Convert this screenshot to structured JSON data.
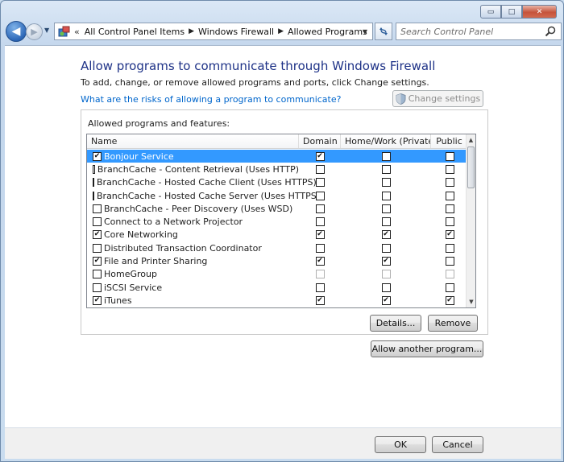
{
  "window": {
    "minimize_glyph": "▭",
    "maximize_glyph": "□",
    "close_glyph": "✕"
  },
  "nav": {
    "back_glyph": "◀",
    "forward_glyph": "▶",
    "breadcrumbs": [
      "All Control Panel Items",
      "Windows Firewall",
      "Allowed Programs"
    ],
    "search_placeholder": "Search Control Panel"
  },
  "page": {
    "title": "Allow programs to communicate through Windows Firewall",
    "subtitle": "To add, change, or remove allowed programs and ports, click Change settings.",
    "risk_link": "What are the risks of allowing a program to communicate?",
    "change_settings_label": "Change settings"
  },
  "allowed": {
    "group_label": "Allowed programs and features:",
    "columns": {
      "name": "Name",
      "domain": "Domain",
      "home": "Home/Work (Private)",
      "public": "Public"
    },
    "rows": [
      {
        "name": "Bonjour Service",
        "enabled": true,
        "domain": true,
        "home": false,
        "public": false,
        "selected": true
      },
      {
        "name": "BranchCache - Content Retrieval (Uses HTTP)",
        "enabled": false,
        "domain": false,
        "home": false,
        "public": false
      },
      {
        "name": "BranchCache - Hosted Cache Client (Uses HTTPS)",
        "enabled": false,
        "domain": false,
        "home": false,
        "public": false
      },
      {
        "name": "BranchCache - Hosted Cache Server (Uses HTTPS)",
        "enabled": false,
        "domain": false,
        "home": false,
        "public": false
      },
      {
        "name": "BranchCache - Peer Discovery (Uses WSD)",
        "enabled": false,
        "domain": false,
        "home": false,
        "public": false
      },
      {
        "name": "Connect to a Network Projector",
        "enabled": false,
        "domain": false,
        "home": false,
        "public": false
      },
      {
        "name": "Core Networking",
        "enabled": true,
        "domain": true,
        "home": true,
        "public": true
      },
      {
        "name": "Distributed Transaction Coordinator",
        "enabled": false,
        "domain": false,
        "home": false,
        "public": false
      },
      {
        "name": "File and Printer Sharing",
        "enabled": true,
        "domain": true,
        "home": true,
        "public": false
      },
      {
        "name": "HomeGroup",
        "enabled": false,
        "domain": false,
        "home": false,
        "public": false,
        "dim": true
      },
      {
        "name": "iSCSI Service",
        "enabled": false,
        "domain": false,
        "home": false,
        "public": false
      },
      {
        "name": "iTunes",
        "enabled": true,
        "domain": true,
        "home": true,
        "public": true
      }
    ],
    "details_label": "Details...",
    "remove_label": "Remove"
  },
  "allow_another_label": "Allow another program...",
  "footer": {
    "ok_label": "OK",
    "cancel_label": "Cancel"
  },
  "colors": {
    "title_blue": "#1e3287",
    "link_blue": "#0066cc",
    "selection_blue": "#3399ff"
  }
}
